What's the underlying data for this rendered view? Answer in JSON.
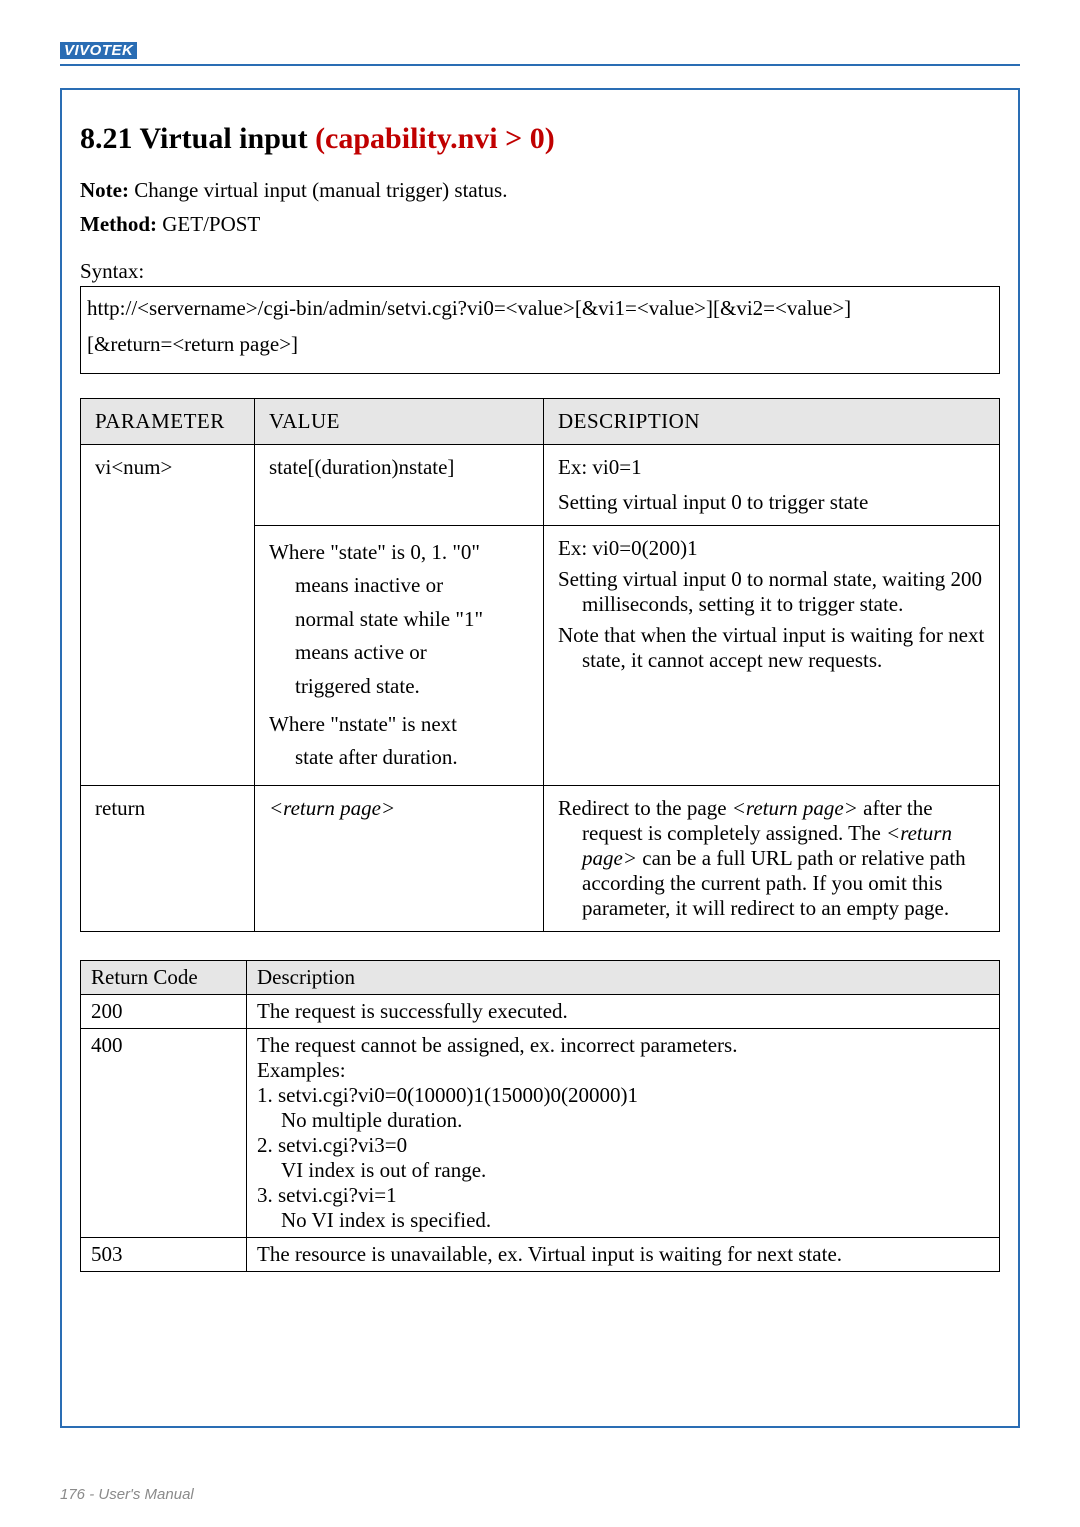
{
  "brand": "VIVOTEK",
  "section": {
    "number": "8.21",
    "title_black": "Virtual input",
    "title_red": "(capability.nvi > 0)"
  },
  "note_label": "Note:",
  "note_text": " Change virtual input (manual trigger) status.",
  "method_label": "Method:",
  "method_text": " GET/POST",
  "syntax_label": "Syntax:",
  "syntax_line1": "http://<servername>/cgi-bin/admin/setvi.cgi?vi0=<value>[&vi1=<value>][&vi2=<value>]",
  "syntax_line2": "[&return=<return page>]",
  "param_table": {
    "headers": {
      "param": "PARAMETER",
      "value": "VALUE",
      "desc": "DESCRIPTION"
    },
    "rows": [
      {
        "param": "vi<num>",
        "value_top": "state[(duration)nstate]",
        "desc_top_l1": "Ex: vi0=1",
        "desc_top_l2": "Setting virtual input 0 to trigger state",
        "value_mid_l1": "Where \"state\" is 0, 1. \"0\"",
        "value_mid_l2": "means inactive or",
        "value_mid_l3": "normal state while \"1\"",
        "value_mid_l4": "means active or",
        "value_mid_l5": "triggered state.",
        "value_mid_l6": "Where \"nstate\" is next",
        "value_mid_l7": "state after duration.",
        "desc_mid_l1": "Ex: vi0=0(200)1",
        "desc_mid_l2a": "Setting virtual input 0 to normal state, waiting 200",
        "desc_mid_l2b": "milliseconds",
        "desc_mid_l2c": ", setting it to trigger state.",
        "desc_mid_l3a": "Note that when the virtual input is waiting for next",
        "desc_mid_l3b": "state, it cannot accept new requests."
      },
      {
        "param": "return",
        "value": "<return page>",
        "desc_l1a": "Redirect to the page ",
        "desc_l1b": "<return page>",
        "desc_l1c": " after the",
        "desc_l2a": "request is completely assigned. The ",
        "desc_l2b": "<return",
        "desc_l3a": "page>",
        "desc_l3b": " can be a full URL path or relative path",
        "desc_l4": "according the current path. If you omit this",
        "desc_l5": "parameter, it will redirect to an empty page."
      }
    ]
  },
  "return_table": {
    "headers": {
      "code": "Return Code",
      "desc": "Description"
    },
    "rows": [
      {
        "code": "200",
        "desc": "The request is successfully executed."
      },
      {
        "code": "400",
        "l1": "The request cannot be assigned, ex. incorrect parameters.",
        "l2": "Examples:",
        "l3": "1. setvi.cgi?vi0=0(10000)1(15000)0(20000)1",
        "l3b": "No multiple duration.",
        "l4": "2. setvi.cgi?vi3=0",
        "l4b": "VI index is out of range.",
        "l5": "3. setvi.cgi?vi=1",
        "l5b": "No VI index is specified."
      },
      {
        "code": "503",
        "desc": "The resource is unavailable, ex. Virtual input is waiting for next state."
      }
    ]
  },
  "footer": "176 - User's Manual"
}
